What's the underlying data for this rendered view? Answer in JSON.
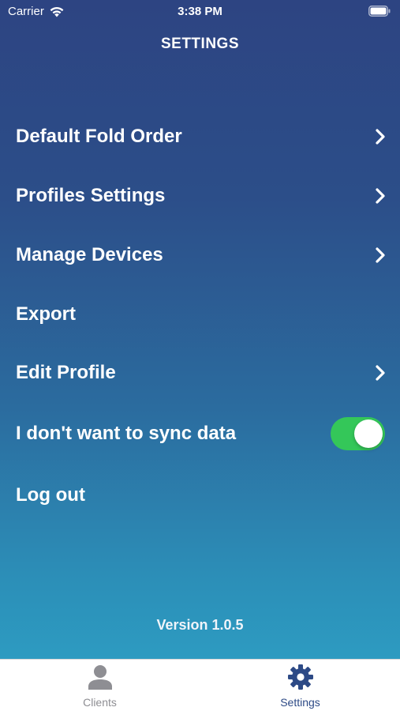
{
  "status_bar": {
    "carrier": "Carrier",
    "time": "3:38 PM",
    "icons": [
      "wifi-icon",
      "battery-icon"
    ]
  },
  "nav": {
    "title": "SETTINGS"
  },
  "menu": {
    "items": [
      {
        "label": "Default Fold Order",
        "accessory": "chevron-right-icon"
      },
      {
        "label": "Profiles Settings",
        "accessory": "chevron-right-icon"
      },
      {
        "label": "Manage Devices",
        "accessory": "chevron-right-icon"
      },
      {
        "label": "Export",
        "accessory": "none"
      },
      {
        "label": "Edit Profile",
        "accessory": "chevron-right-icon"
      },
      {
        "label": "I don't want to sync data",
        "accessory": "toggle",
        "toggle_on": true
      },
      {
        "label": "Log out",
        "accessory": "none"
      }
    ]
  },
  "footer": {
    "version": "Version 1.0.5"
  },
  "tab_bar": {
    "tabs": [
      {
        "label": "Clients",
        "icon": "person-icon",
        "selected": false
      },
      {
        "label": "Settings",
        "icon": "gear-icon",
        "selected": true
      }
    ]
  },
  "colors": {
    "gradient_top": "#2d4482",
    "gradient_bottom": "#2d9bc1",
    "toggle_on": "#34c759",
    "tab_selected": "#2d4a86",
    "tab_unselected": "#8e8e93"
  }
}
